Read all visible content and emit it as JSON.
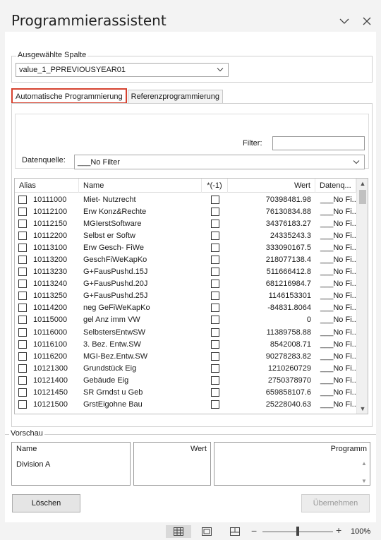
{
  "pane": {
    "title": "Programmierassistent",
    "icons": [
      "chevron-down-icon",
      "close-icon"
    ]
  },
  "column_group": {
    "legend": "Ausgewählte Spalte",
    "selected": "value_1_PPREVIOUSYEAR01"
  },
  "tabs": [
    {
      "label": "Automatische Programmierung",
      "active": true
    },
    {
      "label": "Referenzprogrammierung",
      "active": false
    }
  ],
  "filter": {
    "label": "Filter:",
    "value": ""
  },
  "datasource": {
    "label": "Datenquelle:",
    "selected": "___No Filter"
  },
  "table": {
    "headers": {
      "alias": "Alias",
      "name": "Name",
      "negate": "*(-1)",
      "wert": "Wert",
      "datasource": "Datenq..."
    },
    "rows": [
      {
        "alias": "10111000",
        "name": "Miet- Nutzrecht",
        "wert": "70398481.98",
        "ds": "___No Fi..."
      },
      {
        "alias": "10112100",
        "name": "Erw Konz&Rechte",
        "wert": "76130834.88",
        "ds": "___No Fi..."
      },
      {
        "alias": "10112150",
        "name": "MGIerstSoftware",
        "wert": "34376183.27",
        "ds": "___No Fi..."
      },
      {
        "alias": "10112200",
        "name": "Selbst er Softw",
        "wert": "24335243.3",
        "ds": "___No Fi..."
      },
      {
        "alias": "10113100",
        "name": "Erw Gesch- FiWe",
        "wert": "333090167.5",
        "ds": "___No Fi..."
      },
      {
        "alias": "10113200",
        "name": "GeschFiWeKapKo",
        "wert": "218077138.4",
        "ds": "___No Fi..."
      },
      {
        "alias": "10113230",
        "name": "G+FausPushd.15J",
        "wert": "511666412.8",
        "ds": "___No Fi..."
      },
      {
        "alias": "10113240",
        "name": "G+FausPushd.20J",
        "wert": "681216984.7",
        "ds": "___No Fi..."
      },
      {
        "alias": "10113250",
        "name": "G+FausPushd.25J",
        "wert": "1146153301",
        "ds": "___No Fi..."
      },
      {
        "alias": "10114200",
        "name": "neg GeFiWeKapKo",
        "wert": "-84831.8064",
        "ds": "___No Fi..."
      },
      {
        "alias": "10115000",
        "name": "gel Anz imm VW",
        "wert": "0",
        "ds": "___No Fi..."
      },
      {
        "alias": "10116000",
        "name": "SelbstersEntwSW",
        "wert": "11389758.88",
        "ds": "___No Fi..."
      },
      {
        "alias": "10116100",
        "name": "3. Bez. Entw.SW",
        "wert": "8542008.71",
        "ds": "___No Fi..."
      },
      {
        "alias": "10116200",
        "name": "MGI-Bez.Entw.SW",
        "wert": "90278283.82",
        "ds": "___No Fi..."
      },
      {
        "alias": "10121300",
        "name": "Grundstück Eig",
        "wert": "1210260729",
        "ds": "___No Fi..."
      },
      {
        "alias": "10121400",
        "name": "Gebäude Eig",
        "wert": "2750378970",
        "ds": "___No Fi..."
      },
      {
        "alias": "10121450",
        "name": "SR Grndst u Geb",
        "wert": "659858107.6",
        "ds": "___No Fi..."
      },
      {
        "alias": "10121500",
        "name": "GrstEigohne Bau",
        "wert": "25228040.63",
        "ds": "___No Fi..."
      }
    ]
  },
  "preview": {
    "legend": "Vorschau",
    "name_header": "Name",
    "name_value": "Division A",
    "wert_header": "Wert",
    "programm_header": "Programm"
  },
  "buttons": {
    "delete": "Löschen",
    "apply": "Übernehmen"
  },
  "statusbar": {
    "zoom_minus": "−",
    "zoom_plus": "+",
    "zoom_level": 100,
    "zoom_label": "100%"
  },
  "colors": {
    "active_tab_outline": "#d6422f"
  }
}
